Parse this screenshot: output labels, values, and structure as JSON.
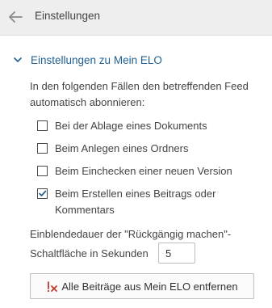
{
  "header": {
    "back_icon": "arrow-left-icon",
    "title": "Einstellungen"
  },
  "section": {
    "toggle_icon": "chevron-down-icon",
    "title": "Einstellungen zu Mein ELO",
    "description": "In den folgenden Fällen den betreffenden Feed automatisch abonnieren:",
    "options": [
      {
        "label": "Bei der Ablage eines Dokuments",
        "checked": false
      },
      {
        "label": "Beim Anlegen eines Ordners",
        "checked": false
      },
      {
        "label": "Beim Einchecken einer neuen Version",
        "checked": false
      },
      {
        "label": "Beim Erstellen eines Beitrags oder Kommentars",
        "checked": true
      }
    ],
    "undo_label_line1": "Einblendedauer der \"Rückgängig machen\"-",
    "undo_label_line2": "Schaltfläche in Sekunden",
    "undo_seconds": "5",
    "remove_button": {
      "icon": "remove-feeds-icon",
      "label": "Alle Beiträge aus Mein ELO entfernen"
    }
  },
  "colors": {
    "accent": "#1f5f91",
    "header_bg": "#eeeeee",
    "remove_icon_red": "#c0392b"
  }
}
